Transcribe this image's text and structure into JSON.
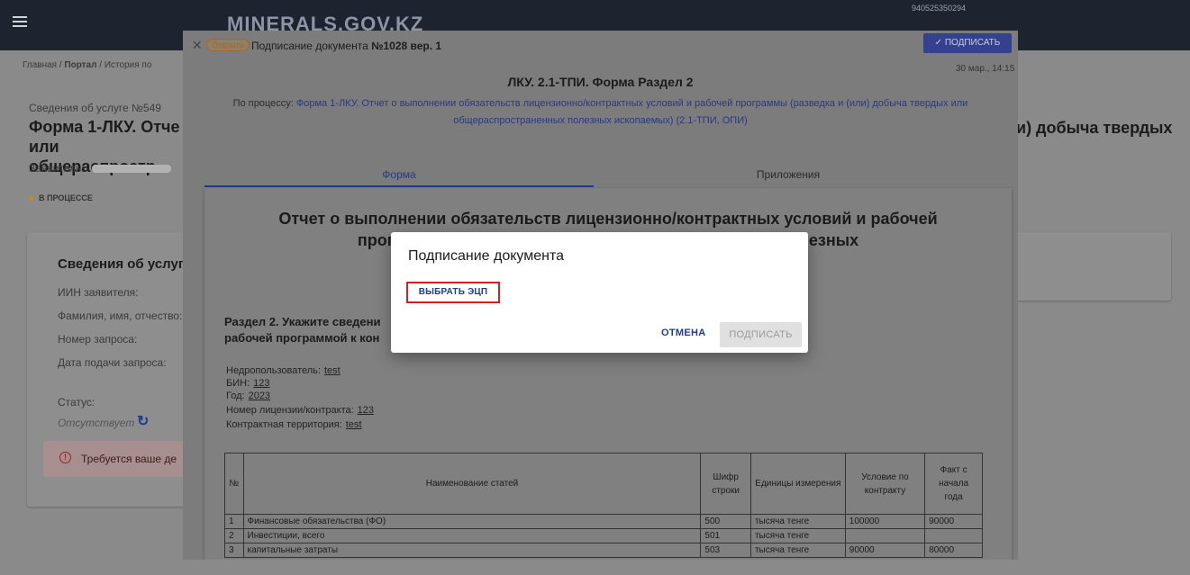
{
  "header": {
    "logo": "MINERALS.GOV.KZ",
    "user_id": "940525350294"
  },
  "breadcrumbs": [
    "Главная",
    "Портал",
    "История по"
  ],
  "service": {
    "number_label": "Сведения об услуге №549",
    "title": "Форма 1-ЛКУ. Отче или общераспростр",
    "title_right": "и) добыча твердых",
    "applicant_label": "Заявитель:",
    "status": "В ПРОЦЕССЕ"
  },
  "left_card": {
    "title": "Сведения об услуге",
    "fields": [
      "ИИН заявителя:",
      "Фамилия, имя, отчество:",
      "Номер запроса:",
      "Дата подачи запроса:"
    ],
    "status_label": "Статус:",
    "status_value": "Отсутствует",
    "warning": "Требуется ваше де"
  },
  "panel": {
    "status_pill": "Открыто",
    "title_prefix": "Подписание документа",
    "title_number": "№1028 вер. 1",
    "sign_button": "ПОДПИСАТЬ",
    "date": "30 мар., 14:15",
    "form_title": "ЛКУ. 2.1-ТПИ. Форма Раздел 2",
    "process_label": "По процессу:",
    "process_link": "Форма 1-ЛКУ. Отчет о выполнении обязательств лицензионно/контрактных условий и рабочей программы (разведка и (или) добыча твердых или общераспространенных полезных ископаемых) (2.1-ТПИ, ОПИ)",
    "tabs": [
      "Форма",
      "Приложения"
    ]
  },
  "document": {
    "heading_line1": "Отчет о выполнении обязательств лицензионно/контрактных условий и рабочей",
    "heading_line2": "программы (разве                                              ненных полезных",
    "section_line1": "Раздел 2. Укажите сведени                                                                    ажении) в соответствии с",
    "section_line2": "рабочей программой к кон",
    "meta": [
      {
        "label": "Недропользователь:",
        "value": "test"
      },
      {
        "label": "БИН:",
        "value": "123"
      },
      {
        "label": "Год:",
        "value": "2023"
      },
      {
        "label": "Номер лицензии/контракта:",
        "value": "123"
      },
      {
        "label": "Контрактная территория:",
        "value": "test"
      }
    ],
    "table": {
      "headers": [
        "№",
        "Наименование статей",
        "Шифр строки",
        "Единицы измерения",
        "Условие по контракту",
        "Факт с начала года"
      ],
      "rows": [
        [
          "1",
          "Финансовые обязательства (ФО)",
          "500",
          "тысяча тенге",
          "100000",
          "90000"
        ],
        [
          "2",
          "Инвестиции, всего",
          "501",
          "тысяча тенге",
          "",
          ""
        ],
        [
          "3",
          "капитальные затраты",
          "503",
          "тысяча тенге",
          "90000",
          "80000"
        ]
      ]
    }
  },
  "dialog": {
    "title": "Подписание документа",
    "choose_button": "ВЫБРАТЬ ЭЦП",
    "cancel_button": "ОТМЕНА",
    "sign_button": "ПОДПИСАТЬ"
  }
}
